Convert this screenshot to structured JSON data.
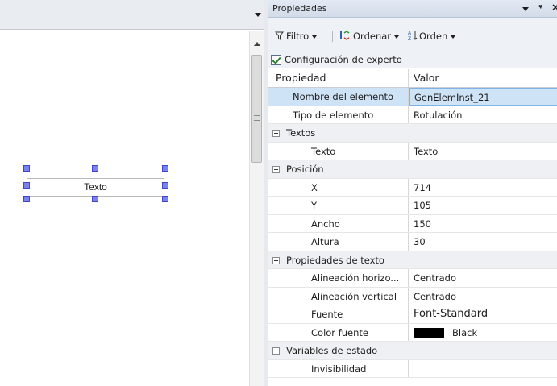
{
  "editor": {
    "text_element_label": "Texto"
  },
  "properties_panel": {
    "title": "Propiedades",
    "pin_glyph": "ᵒ",
    "close_glyph": "✕",
    "toolbar": {
      "filter_label": "Filtro",
      "sort_label": "Ordenar",
      "order_label": "Orden"
    },
    "expert_config": {
      "label": "Configuración de experto",
      "checked": true
    },
    "columns": {
      "property": "Propiedad",
      "value": "Valor"
    },
    "rows": [
      {
        "kind": "prop",
        "indent": 1,
        "name": "Nombre del elemento",
        "value": "GenElemInst_21",
        "selected": true
      },
      {
        "kind": "prop",
        "indent": 1,
        "name": "Tipo de elemento",
        "value": "Rotulación"
      },
      {
        "kind": "cat",
        "name": "Textos"
      },
      {
        "kind": "prop",
        "indent": 2,
        "name": "Texto",
        "value": "Texto"
      },
      {
        "kind": "cat",
        "name": "Posición"
      },
      {
        "kind": "prop",
        "indent": 2,
        "name": "X",
        "value": "714"
      },
      {
        "kind": "prop",
        "indent": 2,
        "name": "Y",
        "value": "105"
      },
      {
        "kind": "prop",
        "indent": 2,
        "name": "Ancho",
        "value": "150"
      },
      {
        "kind": "prop",
        "indent": 2,
        "name": "Altura",
        "value": "30"
      },
      {
        "kind": "cat",
        "name": "Propiedades de texto"
      },
      {
        "kind": "prop",
        "indent": 2,
        "name": "Alineación horizo...",
        "value": "Centrado"
      },
      {
        "kind": "prop",
        "indent": 2,
        "name": "Alineación vertical",
        "value": "Centrado"
      },
      {
        "kind": "prop",
        "indent": 2,
        "name": "Fuente",
        "value": "Font-Standard"
      },
      {
        "kind": "prop",
        "indent": 2,
        "name": "Color fuente",
        "value": "Black",
        "swatch_color": "#000000"
      },
      {
        "kind": "cat",
        "name": "Variables de estado"
      },
      {
        "kind": "prop",
        "indent": 2,
        "name": "Invisibilidad",
        "value": ""
      }
    ]
  }
}
